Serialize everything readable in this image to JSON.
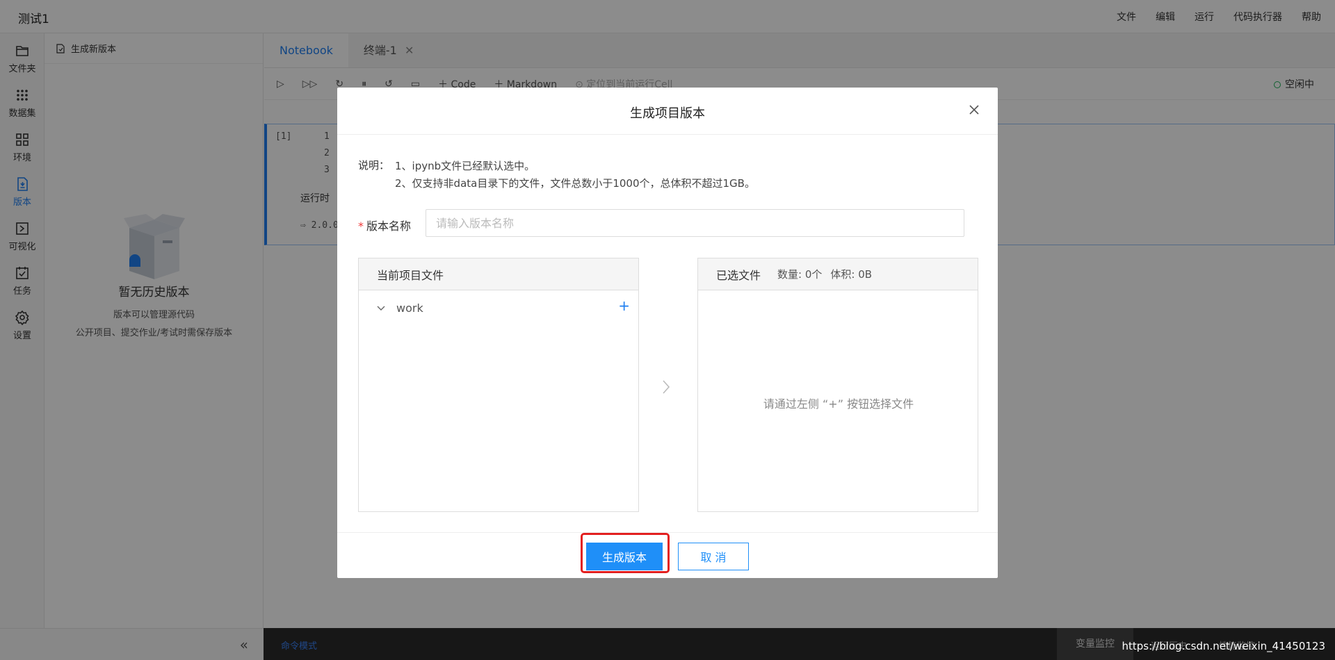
{
  "app": {
    "title": "测试1",
    "menu": [
      "文件",
      "编辑",
      "运行",
      "代码执行器",
      "帮助"
    ]
  },
  "activity": [
    {
      "label": "文件夹",
      "icon": "folder-icon"
    },
    {
      "label": "数据集",
      "icon": "dataset-icon"
    },
    {
      "label": "环境",
      "icon": "environment-icon"
    },
    {
      "label": "版本",
      "icon": "version-icon"
    },
    {
      "label": "可视化",
      "icon": "visualization-icon"
    },
    {
      "label": "任务",
      "icon": "task-icon"
    },
    {
      "label": "设置",
      "icon": "settings-icon"
    }
  ],
  "side": {
    "new_version": "生成新版本",
    "empty_title": "暂无历史版本",
    "empty_desc_1": "版本可以管理源代码",
    "empty_desc_2": "公开项目、提交作业/考试时需保存版本"
  },
  "editor": {
    "tabs": [
      "Notebook",
      "终端-1"
    ],
    "toolbar_code": "Code",
    "toolbar_markdown": "Markdown",
    "toolbar_locate": "定位到当前运行Cell",
    "status": "空闲中",
    "cell_number": "[1]",
    "line_numbers": [
      "1",
      "2",
      "3"
    ],
    "runtime_label": "运行时",
    "output_text": "2.0.0-"
  },
  "bottom": {
    "mode": "命令模式",
    "var_monitor": "变量监控",
    "tools": [
      "运行历史",
      "性能监控"
    ]
  },
  "watermark": "https://blog.csdn.net/weixin_41450123",
  "modal": {
    "title": "生成项目版本",
    "note_label": "说明：",
    "note_1": "1、ipynb文件已经默认选中。",
    "note_2": "2、仅支持非data目录下的文件，文件总数小于1000个，总体积不超过1GB。",
    "required_mark": "*",
    "field_label": "版本名称",
    "field_placeholder": "请输入版本名称",
    "field_value": "",
    "left_panel_title": "当前项目文件",
    "tree_item": "work",
    "tree_add": "+",
    "right_panel_title": "已选文件",
    "right_count": "数量: 0个",
    "right_size": "体积: 0B",
    "right_empty": "请通过左侧 “+” 按钮选择文件",
    "btn_generate": "生成版本",
    "btn_cancel": "取 消",
    "accent_color": "#1f8ff8",
    "highlight_color": "#e31f1f"
  }
}
